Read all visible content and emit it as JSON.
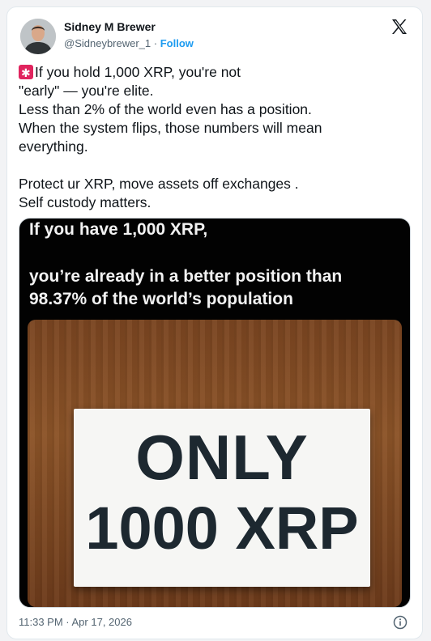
{
  "tweet": {
    "author_name": "Sidney M Brewer",
    "handle": "@Sidneybrewer_1",
    "separator": " · ",
    "follow_label": "Follow",
    "text_p1": "If you hold 1,000 XRP, you're not\n\"early\" — you're elite.\nLess than 2% of the world even has a position.\nWhen the system flips, those numbers will mean\neverything.",
    "text_p2": "Protect ur XRP, move assets off exchanges .\nSelf custody matters.",
    "timestamp": "11:33 PM · Apr 17, 2026"
  },
  "media": {
    "caption_line1": "If you have 1,000 XRP,",
    "caption_line2": "you’re already in a better position than 98.37% of the world’s population",
    "sign_line1": "ONLY",
    "sign_line2": "1000 XRP"
  },
  "icons": {
    "emoji": "police-siren-emoji",
    "brand": "x-logo",
    "info": "info-icon"
  },
  "colors": {
    "follow": "#1d9bf0",
    "text": "#0f1419",
    "muted": "#536471"
  }
}
